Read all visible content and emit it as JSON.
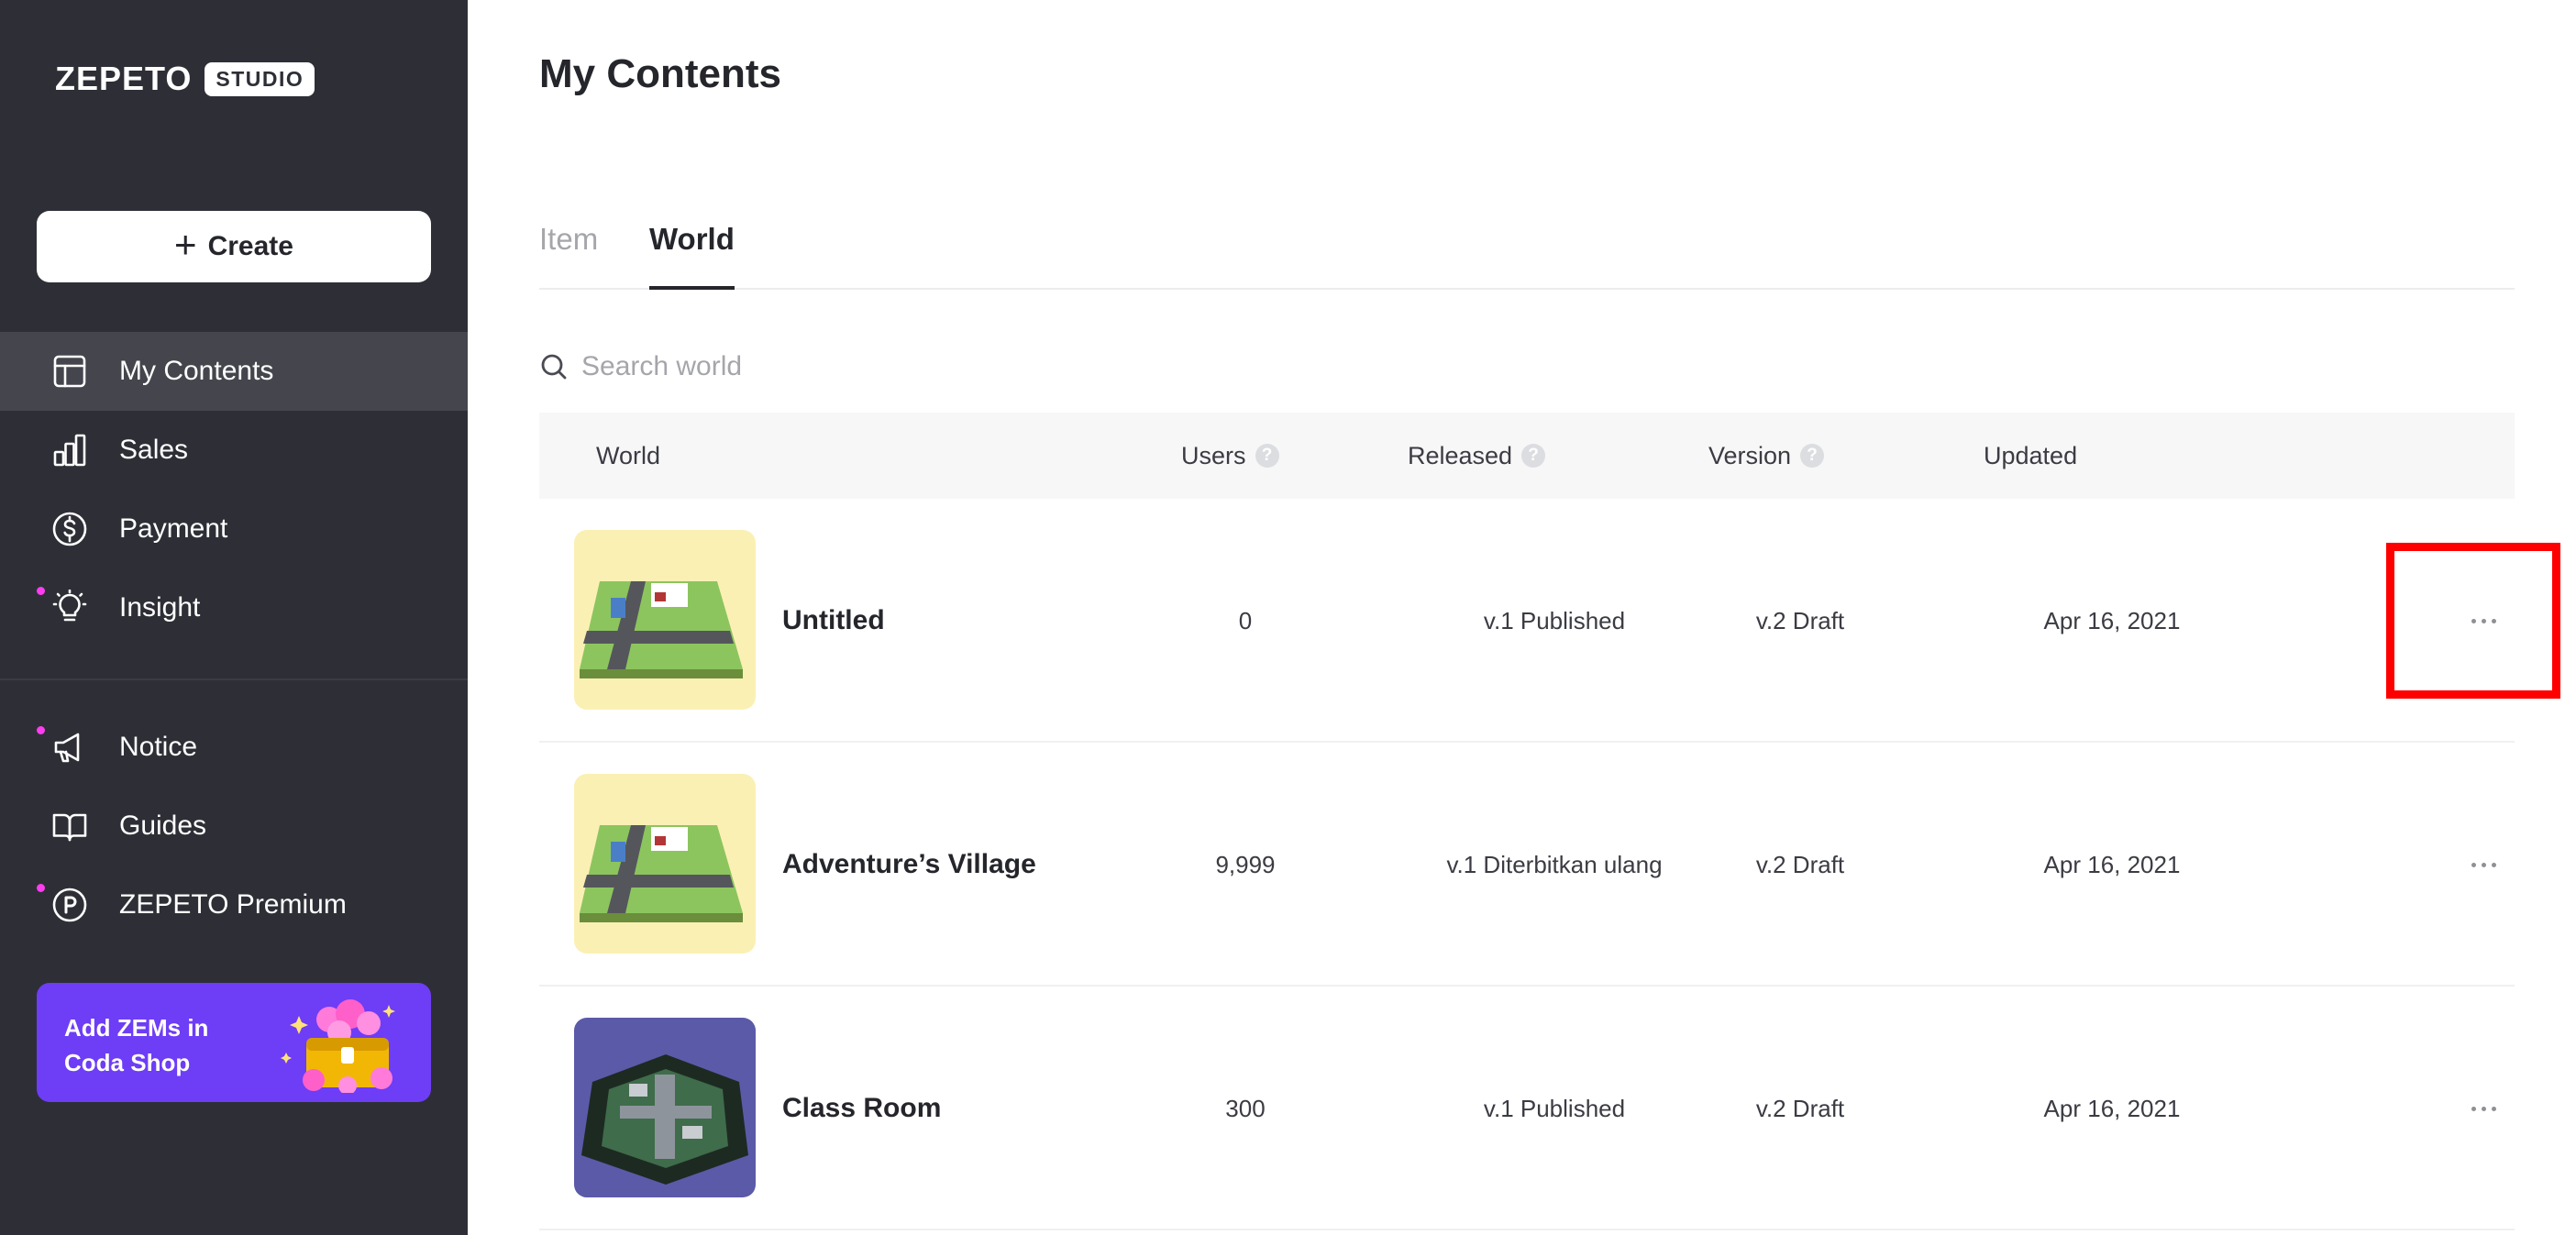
{
  "brand": {
    "word": "ZEPETO",
    "badge": "STUDIO"
  },
  "sidebar": {
    "create_label": "Create",
    "items": [
      {
        "label": "My Contents",
        "icon": "layout-icon",
        "active": true,
        "dot": false
      },
      {
        "label": "Sales",
        "icon": "bar-chart-icon",
        "active": false,
        "dot": false
      },
      {
        "label": "Payment",
        "icon": "dollar-circle-icon",
        "active": false,
        "dot": false
      },
      {
        "label": "Insight",
        "icon": "lightbulb-icon",
        "active": false,
        "dot": true
      }
    ],
    "secondary_items": [
      {
        "label": "Notice",
        "icon": "megaphone-icon",
        "dot": true
      },
      {
        "label": "Guides",
        "icon": "book-icon",
        "dot": false
      },
      {
        "label": "ZEPETO Premium",
        "icon": "premium-p-icon",
        "dot": true
      }
    ],
    "promo": {
      "line1": "Add ZEMs in",
      "line2": "Coda Shop"
    },
    "accent": "#6e3df6",
    "dot_color": "#ff3df0"
  },
  "main": {
    "title": "My Contents",
    "tabs": [
      {
        "label": "Item",
        "active": false
      },
      {
        "label": "World",
        "active": true
      }
    ],
    "search_placeholder": "Search world",
    "columns": {
      "world": "World",
      "users": "Users",
      "released": "Released",
      "version": "Version",
      "updated": "Updated",
      "help_glyph": "?"
    },
    "rows": [
      {
        "name": "Untitled",
        "users": "0",
        "released": "v.1  Published",
        "version": "v.2  Draft",
        "updated": "Apr 16, 2021",
        "thumb": "village-thumb"
      },
      {
        "name": "Adventure’s Village",
        "users": "9,999",
        "released": "v.1  Diterbitkan ulang",
        "version": "v.2  Draft",
        "updated": "Apr 16, 2021",
        "thumb": "village-thumb"
      },
      {
        "name": "Class Room",
        "users": "300",
        "released": "v.1  Published",
        "version": "v.2  Draft",
        "updated": "Apr 16, 2021",
        "thumb": "classroom-thumb"
      }
    ]
  }
}
